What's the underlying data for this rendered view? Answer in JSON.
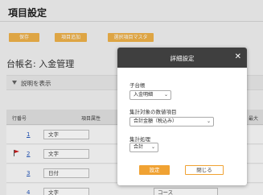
{
  "page": {
    "title": "項目設定"
  },
  "toolbar": {
    "save": "保存",
    "add_item": "項目追加",
    "master": "選択項目マスタ"
  },
  "account": {
    "label": "台帳名: 入金管理"
  },
  "expander": {
    "label": "説明を表示"
  },
  "table": {
    "headers": [
      "行番号",
      "項目属性",
      "最大"
    ],
    "rows": [
      {
        "num": "1",
        "attr": "文字",
        "name": "",
        "flag": false
      },
      {
        "num": "2",
        "attr": "文字",
        "name": "",
        "flag": true
      },
      {
        "num": "3",
        "attr": "日付",
        "name": "",
        "flag": false
      },
      {
        "num": "4",
        "attr": "文字",
        "name": "コース",
        "flag": false
      }
    ]
  },
  "modal": {
    "title": "詳細設定",
    "fields": [
      {
        "label": "子台帳",
        "value": "入金明細"
      },
      {
        "label": "集計対象の数値項目",
        "value": "合計金額（税込み）"
      },
      {
        "label": "集計処理",
        "value": "合計"
      }
    ],
    "ok": "設定",
    "close": "閉じる"
  },
  "colors": {
    "accent": "#f0a233",
    "modal_header": "#3f3f3f",
    "link": "#2255bb"
  }
}
